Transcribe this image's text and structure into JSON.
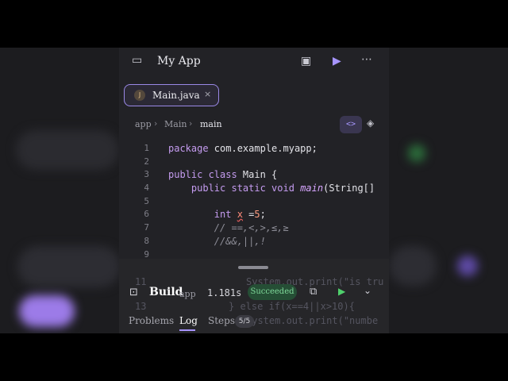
{
  "app": {
    "title": "My App",
    "actions": {
      "save": "save-icon",
      "run": "play-icon",
      "more": "more-icon"
    }
  },
  "tab": {
    "badge": "J",
    "name": "Main.java",
    "close": "×"
  },
  "breadcrumb": {
    "items": [
      "app",
      "Main",
      "main"
    ]
  },
  "editor": {
    "lines": [
      {
        "n": "1",
        "text": "package com.example.myapp;"
      },
      {
        "n": "2",
        "text": ""
      },
      {
        "n": "3",
        "text": "public class Main {"
      },
      {
        "n": "4",
        "text": "    public static void main(String[]"
      },
      {
        "n": "5",
        "text": ""
      },
      {
        "n": "6",
        "text": "        int x =5;"
      },
      {
        "n": "7",
        "text": "        // ==,<,>,<=,>="
      },
      {
        "n": "8",
        "text": "        //&&,||,!"
      },
      {
        "n": "9",
        "text": ""
      }
    ],
    "ghost": [
      {
        "n": "11",
        "text": "System.out.print(\"is tru"
      },
      {
        "n": "13",
        "text": "} else if(x==4||x>10){"
      },
      {
        "n": "",
        "text": "System.out.print(\"numbe"
      }
    ]
  },
  "build": {
    "title": "Build",
    "target": "app",
    "time": "1.181s",
    "status": "Succeeded",
    "status_color": "#7fd99a"
  },
  "panel": {
    "tabs": [
      "Problems",
      "Log",
      "Steps"
    ],
    "active": "Log",
    "steps_badge": "5/5"
  },
  "colors": {
    "accent": "#a793ff",
    "success": "#4fd06c"
  }
}
